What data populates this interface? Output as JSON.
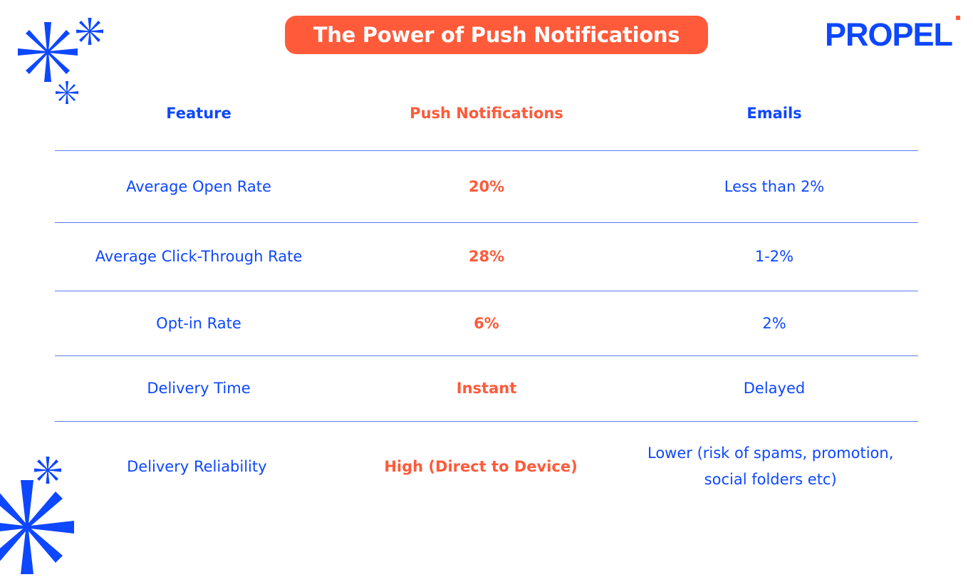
{
  "title": "The Power of Push Notifications",
  "brand": {
    "logo_text": "PROPEL",
    "primary_color": "#0d47ff",
    "accent_color": "#ff5a3a"
  },
  "decorations": [
    "asterisk-star-large",
    "asterisk-star-small",
    "asterisk-star-small",
    "asterisk-star-small",
    "asterisk-star-large"
  ],
  "table": {
    "headers": {
      "feature": "Feature",
      "push": "Push Notifications",
      "email": "Emails"
    },
    "rows": [
      {
        "feature": "Average Open Rate",
        "push": "20%",
        "email": "Less than 2%"
      },
      {
        "feature": "Average Click-Through Rate",
        "push": "28%",
        "email": "1-2%"
      },
      {
        "feature": "Opt-in Rate",
        "push": "6%",
        "email": "2%"
      },
      {
        "feature": "Delivery Time",
        "push": "Instant",
        "email": "Delayed"
      },
      {
        "feature": "Delivery Reliability",
        "push": "High (Direct to Device)",
        "email": "Lower (risk of spams, promotion, social folders etc)"
      }
    ]
  }
}
